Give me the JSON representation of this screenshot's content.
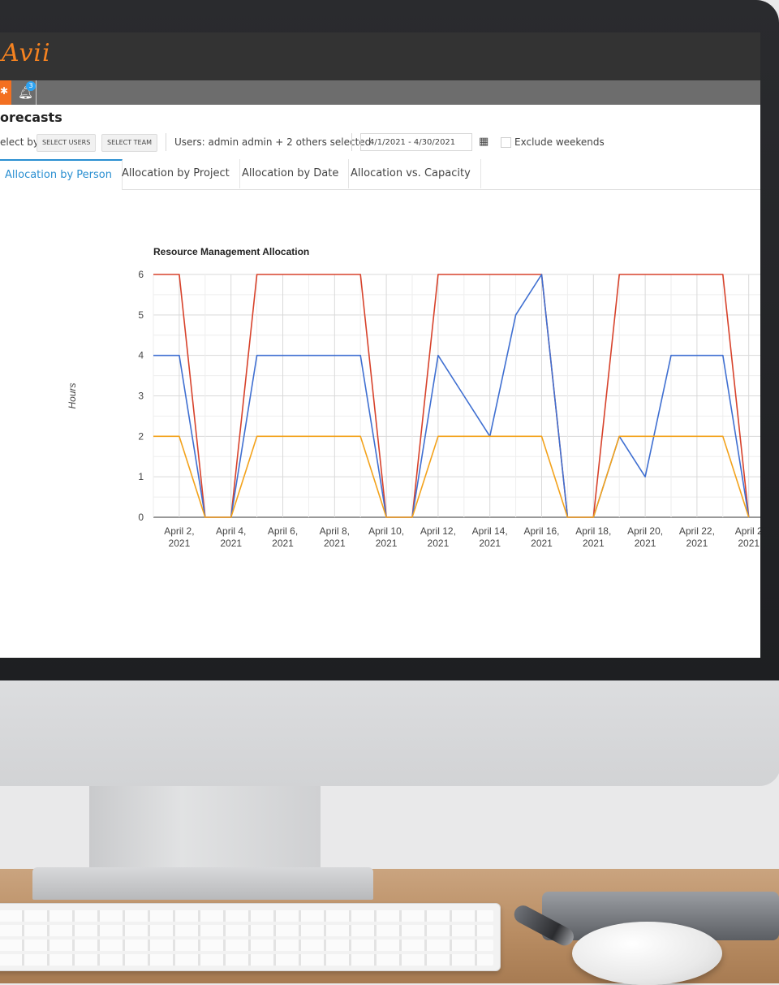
{
  "app": {
    "logo_text": "Avii",
    "notification_count": "3"
  },
  "page": {
    "title": "orecasts"
  },
  "filters": {
    "select_by_label": "elect by:",
    "select_users_btn": "SELECT USERS",
    "select_team_btn": "SELECT TEAM",
    "users_text": "Users: admin admin + 2 others selected",
    "date_range": "4/1/2021 - 4/30/2021",
    "exclude_weekends": "Exclude weekends"
  },
  "tabs": [
    {
      "label": "Allocation by Person",
      "active": true
    },
    {
      "label": "Allocation by Project",
      "active": false
    },
    {
      "label": "Allocation by Date",
      "active": false
    },
    {
      "label": "Allocation vs. Capacity",
      "active": false
    }
  ],
  "icons": {
    "gear": "gear-icon",
    "bell": "bell-icon",
    "calendar": "calendar-icon"
  },
  "colors": {
    "accent": "#2a8fd1",
    "brand_orange": "#f37021",
    "header_bg": "#333333"
  },
  "chart_data": {
    "type": "line",
    "title": "Resource Management Allocation",
    "ylabel": "Hours",
    "xlabel": "",
    "ylim": [
      0,
      6
    ],
    "yticks": [
      0,
      1,
      2,
      3,
      4,
      5,
      6
    ],
    "grid": true,
    "xticks": [
      {
        "day": 2,
        "line1": "April 2,",
        "line2": "2021"
      },
      {
        "day": 4,
        "line1": "April 4,",
        "line2": "2021"
      },
      {
        "day": 6,
        "line1": "April 6,",
        "line2": "2021"
      },
      {
        "day": 8,
        "line1": "April 8,",
        "line2": "2021"
      },
      {
        "day": 10,
        "line1": "April 10,",
        "line2": "2021"
      },
      {
        "day": 12,
        "line1": "April 12,",
        "line2": "2021"
      },
      {
        "day": 14,
        "line1": "April 14,",
        "line2": "2021"
      },
      {
        "day": 16,
        "line1": "April 16,",
        "line2": "2021"
      },
      {
        "day": 18,
        "line1": "April 18,",
        "line2": "2021"
      },
      {
        "day": 20,
        "line1": "April 20,",
        "line2": "2021"
      },
      {
        "day": 22,
        "line1": "April 22,",
        "line2": "2021"
      },
      {
        "day": 24,
        "line1": "April 2",
        "line2": "2021"
      }
    ],
    "x": [
      1,
      2,
      3,
      4,
      5,
      6,
      7,
      8,
      9,
      10,
      11,
      12,
      13,
      14,
      15,
      16,
      17,
      18,
      19,
      20,
      21,
      22,
      23,
      24
    ],
    "series": [
      {
        "color": "#d7422b",
        "values": [
          6,
          6,
          0,
          0,
          6,
          6,
          6,
          6,
          6,
          0,
          0,
          6,
          6,
          6,
          6,
          6,
          0,
          0,
          6,
          6,
          6,
          6,
          6,
          0
        ]
      },
      {
        "color": "#3f6fd1",
        "values": [
          4,
          4,
          0,
          0,
          4,
          4,
          4,
          4,
          4,
          0,
          0,
          4,
          3,
          2,
          5,
          6,
          0,
          0,
          2,
          1,
          4,
          4,
          4,
          0
        ]
      },
      {
        "color": "#f3a21b",
        "values": [
          2,
          2,
          0,
          0,
          2,
          2,
          2,
          2,
          2,
          0,
          0,
          2,
          2,
          2,
          2,
          2,
          0,
          0,
          2,
          2,
          2,
          2,
          2,
          0
        ]
      }
    ]
  }
}
